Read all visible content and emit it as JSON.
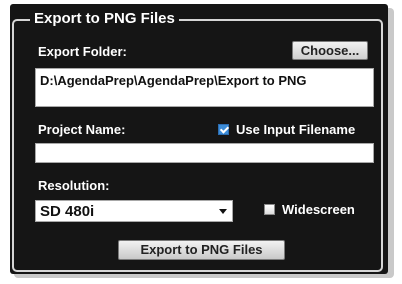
{
  "group_title": "Export to PNG Files",
  "export_folder": {
    "label": "Export Folder:",
    "choose_label": "Choose...",
    "path": "D:\\AgendaPrep\\AgendaPrep\\Export to PNG"
  },
  "project": {
    "label": "Project Name:",
    "use_input_filename_label": "Use Input Filename",
    "use_input_filename_checked": true,
    "value": ""
  },
  "resolution": {
    "label": "Resolution:",
    "selected": "SD 480i",
    "widescreen_label": "Widescreen",
    "widescreen_checked": false
  },
  "export_button_label": "Export to PNG Files"
}
